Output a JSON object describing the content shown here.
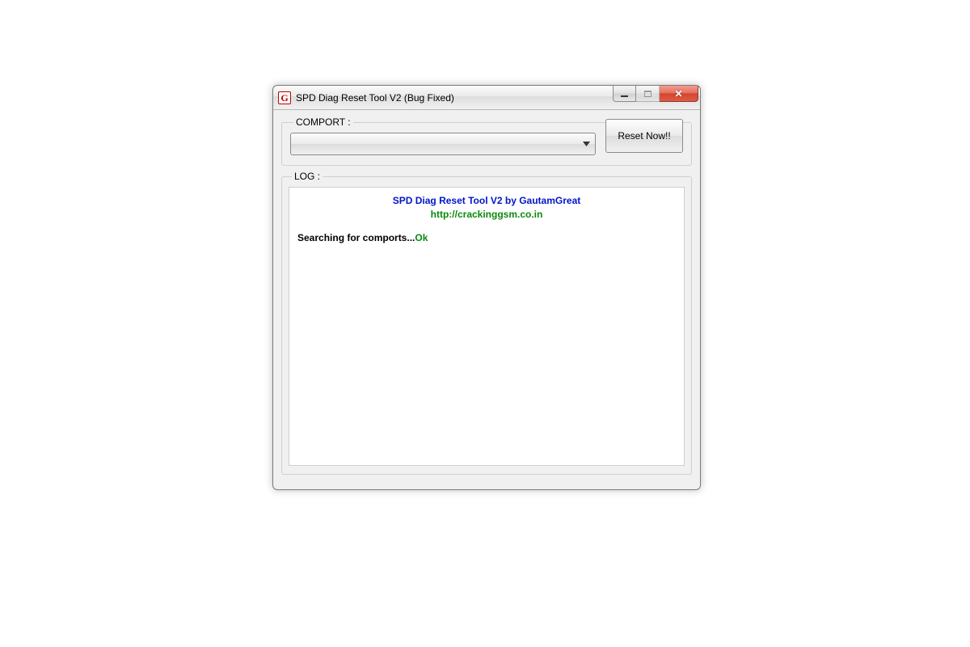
{
  "window": {
    "icon_letter": "G",
    "title": "SPD Diag Reset Tool V2  (Bug Fixed)"
  },
  "comport": {
    "legend": "COMPORT :",
    "selected_value": "",
    "reset_button_label": "Reset Now!!"
  },
  "log": {
    "legend": "LOG :",
    "header_line1": "SPD Diag Reset Tool V2 by GautamGreat",
    "header_line2": "http://crackinggsm.co.in",
    "search_label": "Searching for comports...",
    "search_status": "Ok"
  }
}
